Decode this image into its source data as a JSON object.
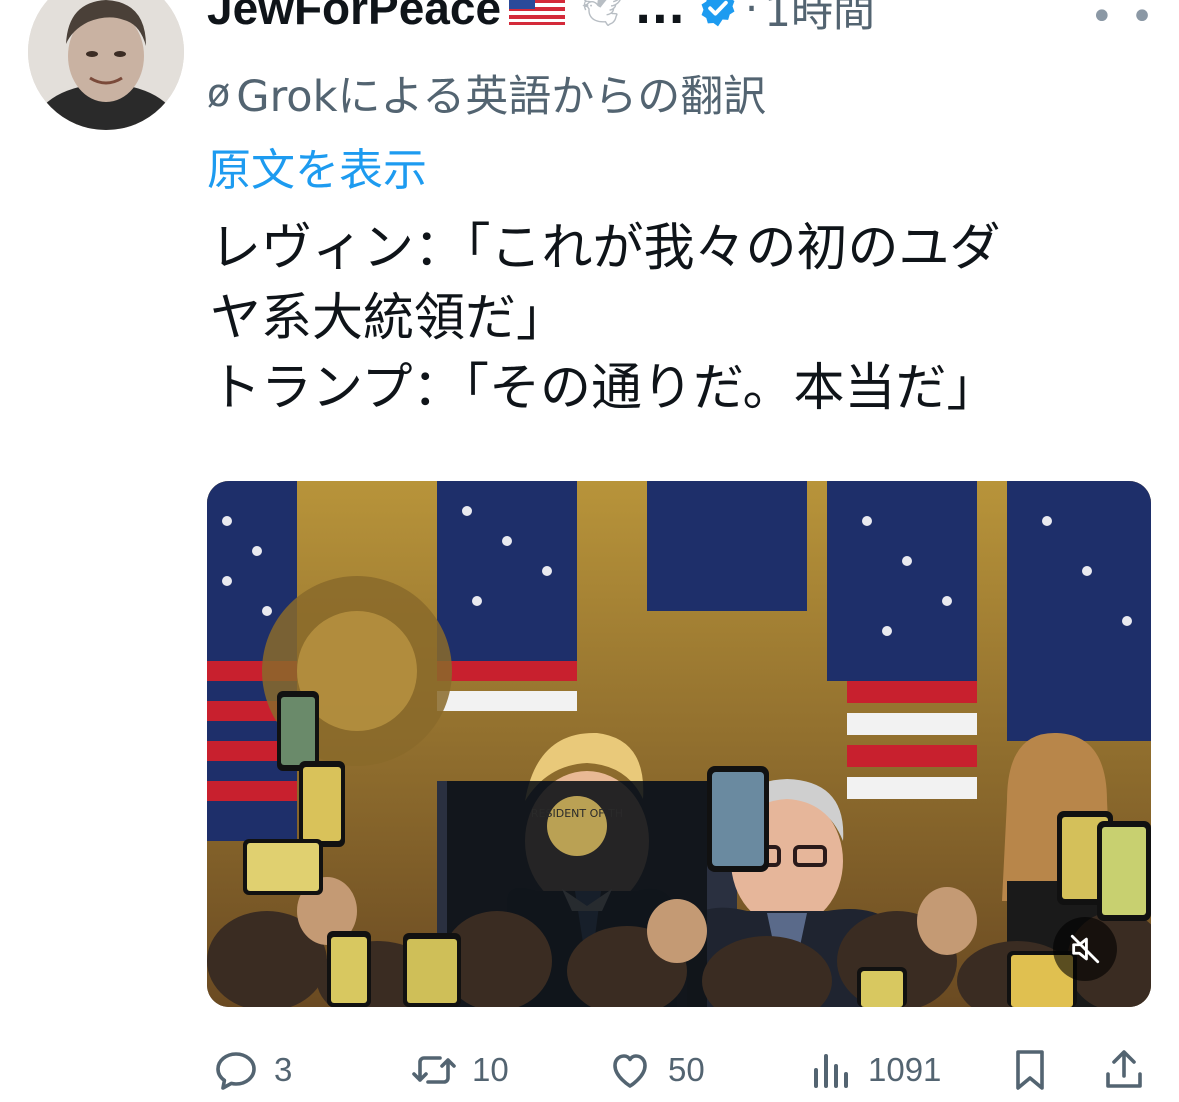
{
  "author": {
    "name": "JewForPeace",
    "verified": true,
    "flag": "us-flag",
    "badge": "dove-icon",
    "ellipsis": "...",
    "time_sep": "·",
    "time": "1時間"
  },
  "translation": {
    "label": "Grokによる英語からの翻訳",
    "icon": "translate-icon",
    "show_original": "原文を表示"
  },
  "tweet": {
    "lines": [
      "レヴィン：「これが我々の初のユダ",
      "ヤ系大統領だ」",
      "トランプ：「その通りだ。本当だ」"
    ]
  },
  "media": {
    "type": "video",
    "muted": true,
    "seal_text": "RESIDENT OF TH"
  },
  "actions": {
    "reply": "3",
    "retweet": "10",
    "like": "50",
    "views": "1091"
  },
  "colors": {
    "text": "#0f1419",
    "secondary": "#536471",
    "link": "#1d9bf0",
    "verified": "#1d9bf0"
  }
}
